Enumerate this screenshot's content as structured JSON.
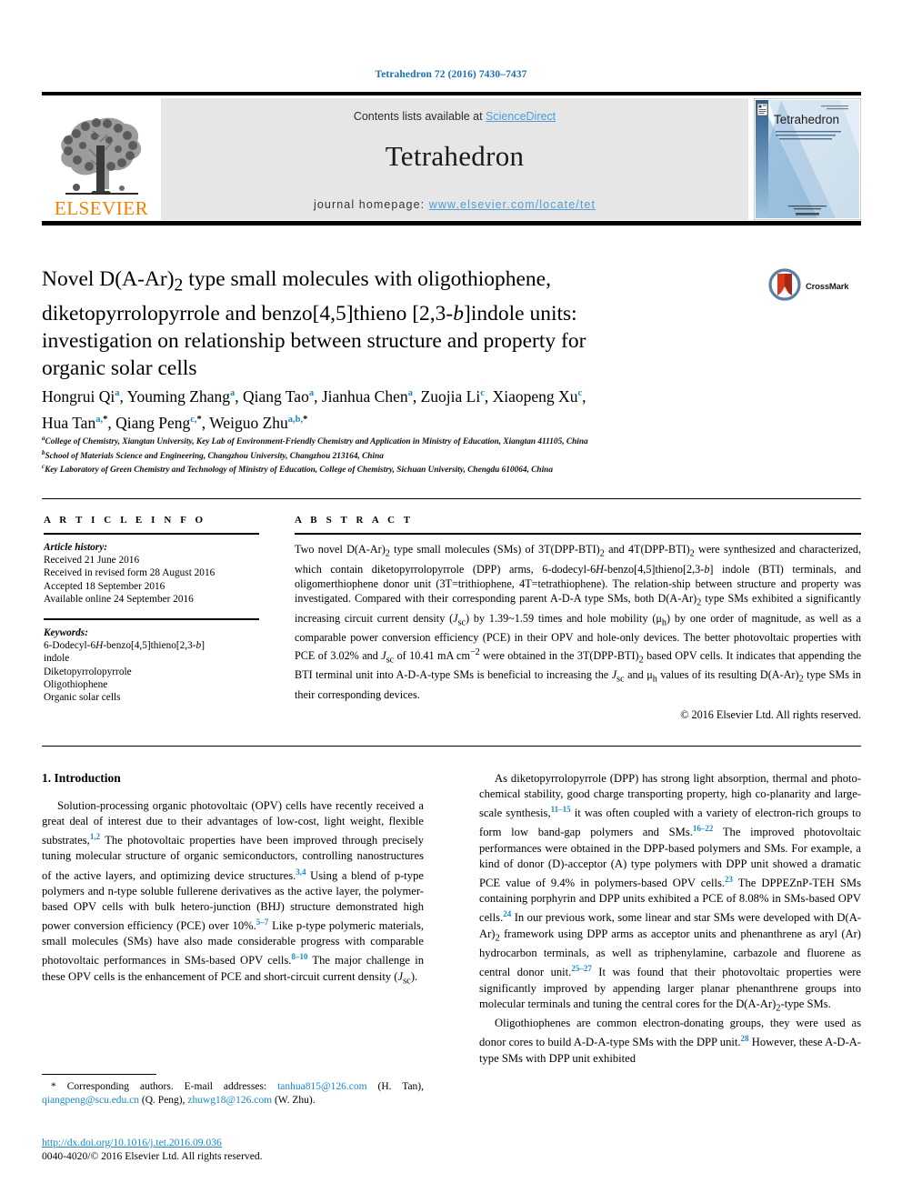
{
  "running_head": "Tetrahedron 72 (2016) 7430–7437",
  "masthead": {
    "contents_prefix": "Contents lists available at ",
    "sciencedirect": "ScienceDirect",
    "journal_title": "Tetrahedron",
    "homepage_prefix": "journal homepage: ",
    "homepage_url": "www.elsevier.com/locate/tet",
    "publisher_logo_text": "ELSEVIER",
    "publisher_logo_icon": "elsevier-tree-icon",
    "cover_title": "Tetrahedron"
  },
  "article": {
    "title_line1": "Novel D(A-Ar)2 type small molecules with oligothiophene,",
    "title_line2": "diketopyrrolopyrrole and benzo[4,5]thieno [2,3-b]indole units:",
    "title_line3": "investigation on relationship between structure and property for",
    "title_line4": "organic solar cells",
    "crossmark_label": "CrossMark"
  },
  "authors": [
    {
      "name": "Hongrui Qi",
      "sup": "a"
    },
    {
      "name": "Youming Zhang",
      "sup": "a"
    },
    {
      "name": "Qiang Tao",
      "sup": "a"
    },
    {
      "name": "Jianhua Chen",
      "sup": "a"
    },
    {
      "name": "Zuojia Li",
      "sup": "c"
    },
    {
      "name": "Xiaopeng Xu",
      "sup": "c"
    },
    {
      "name": "Hua Tan",
      "sup": "a,*"
    },
    {
      "name": "Qiang Peng",
      "sup": "c,*"
    },
    {
      "name": "Weiguo Zhu",
      "sup": "a,b,*"
    }
  ],
  "affiliations": [
    {
      "marker": "a",
      "text": "College of Chemistry, Xiangtan University, Key Lab of Environment-Friendly Chemistry and Application in Ministry of Education, Xiangtan 411105, China"
    },
    {
      "marker": "b",
      "text": "School of Materials Science and Engineering, Changzhou University, Changzhou 213164, China"
    },
    {
      "marker": "c",
      "text": "Key Laboratory of Green Chemistry and Technology of Ministry of Education, College of Chemistry, Sichuan University, Chengdu 610064, China"
    }
  ],
  "article_info": {
    "heading": "A R T I C L E   I N F O",
    "history_heading": "Article history:",
    "history": [
      "Received 21 June 2016",
      "Received in revised form 28 August 2016",
      "Accepted 18 September 2016",
      "Available online 24 September 2016"
    ],
    "keywords_heading": "Keywords:",
    "keywords": [
      "6-Dodecyl-6H-benzo[4,5]thieno[2,3-b]indole",
      "Diketopyrrolopyrrole",
      "Oligothiophene",
      "Organic solar cells"
    ]
  },
  "abstract": {
    "heading": "A B S T R A C T",
    "body": "Two novel D(A-Ar)2 type small molecules (SMs) of 3T(DPP-BTI)2 and 4T(DPP-BTI)2 were synthesized and characterized, which contain diketopyrrolopyrrole (DPP) arms, 6-dodecyl-6H-benzo[4,5]thieno[2,3-b] indole (BTI) terminals, and oligomerthiophene donor unit (3T=trithiophene, 4T=tetrathiophene). The relation-ship between structure and property was investigated. Compared with their corresponding parent A-D-A type SMs, both D(A-Ar)2 type SMs exhibited a significantly increasing circuit current density (Jsc) by 1.39~1.59 times and hole mobility (μh) by one order of magnitude, as well as a comparable power conversion efficiency (PCE) in their OPV and hole-only devices. The better photovoltaic properties with PCE of 3.02% and Jsc of 10.41 mA cm−2 were obtained in the 3T(DPP-BTI)2 based OPV cells. It indicates that appending the BTI terminal unit into A-D-A-type SMs is beneficial to increasing the Jsc and μh values of its resulting D(A-Ar)2 type SMs in their corresponding devices.",
    "copyright": "© 2016 Elsevier Ltd. All rights reserved."
  },
  "body": {
    "section_heading": "1. Introduction",
    "left_paragraph_1": "Solution-processing organic photovoltaic (OPV) cells have recently received a great deal of interest due to their advantages of low-cost, light weight, flexible substrates,1,2 The photovoltaic properties have been improved through precisely tuning molecular structure of organic semiconductors, controlling nanostructures of the active layers, and optimizing device structures.3,4 Using a blend of p-type polymers and n-type soluble fullerene derivatives as the active layer, the polymer-based OPV cells with bulk hetero-junction (BHJ) structure demonstrated high power conversion efficiency (PCE) over 10%.5–7 Like p-type polymeric materials, small molecules (SMs) have also made considerable progress with comparable photovoltaic performances in SMs-based OPV cells.8–10 The major challenge in these OPV cells is the enhancement of PCE and short-circuit current density (Jsc).",
    "right_paragraph_1": "As diketopyrrolopyrrole (DPP) has strong light absorption, thermal and photo-chemical stability, good charge transporting property, high co-planarity and large-scale synthesis,11–15 it was often coupled with a variety of electron-rich groups to form low band-gap polymers and SMs.16–22 The improved photovoltaic performances were obtained in the DPP-based polymers and SMs. For example, a kind of donor (D)-acceptor (A) type polymers with DPP unit showed a dramatic PCE value of 9.4% in polymers-based OPV cells.23 The DPPEZnP-TEH SMs containing porphyrin and DPP units exhibited a PCE of 8.08% in SMs-based OPV cells.24 In our previous work, some linear and star SMs were developed with D(A-Ar)2 framework using DPP arms as acceptor units and phenanthrene as aryl (Ar) hydrocarbon terminals, as well as triphenylamine, carbazole and fluorene as central donor unit.25–27 It was found that their photovoltaic properties were significantly improved by appending larger planar phenanthrene groups into molecular terminals and tuning the central cores for the D(A-Ar)2-type SMs.",
    "right_paragraph_2": "Oligothiophenes are common electron-donating groups, they were used as donor cores to build A-D-A-type SMs with the DPP unit.28 However, these A-D-A-type SMs with DPP unit exhibited"
  },
  "footer": {
    "corresponding_prefix": "* Corresponding authors. E-mail addresses: ",
    "emails": [
      {
        "address": "tanhua815@126.com",
        "owner": "(H. Tan)"
      },
      {
        "address": "qiangpeng@scu.edu.cn",
        "owner": "(Q. Peng)"
      },
      {
        "address": "zhuwg18@126.com",
        "owner": "(W. Zhu)"
      }
    ],
    "doi": "http://dx.doi.org/10.1016/j.tet.2016.09.036",
    "issn_line": "0040-4020/© 2016 Elsevier Ltd. All rights reserved."
  },
  "colors": {
    "link_blue": "#1a87c9",
    "sciencedirect_blue": "#4a9fd8",
    "elsevier_orange": "#f08000",
    "band_gray": "#e6e6e6"
  }
}
